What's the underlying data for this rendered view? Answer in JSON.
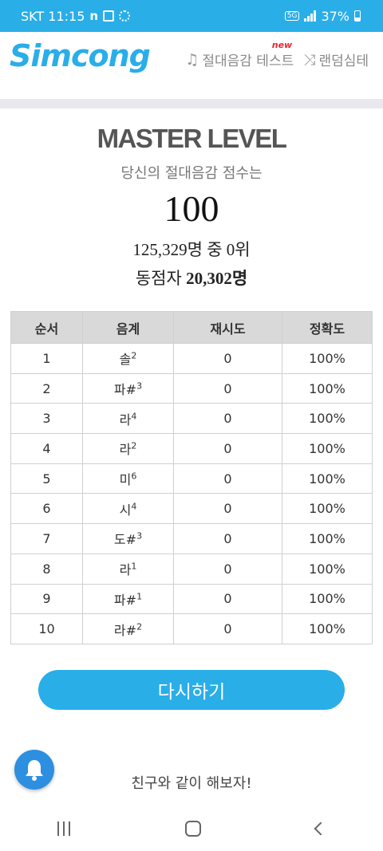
{
  "status_bar": {
    "carrier_time": "SKT 11:15",
    "battery": "37%",
    "network": "5G"
  },
  "header": {
    "logo": "Simcong",
    "nav_test": "절대음감 테스트",
    "nav_new": "new",
    "nav_random": "랜덤심테"
  },
  "result": {
    "level": "MASTER LEVEL",
    "subtitle": "당신의 절대음감 점수는",
    "score": "100",
    "rank": "125,329명 중 0위",
    "ties_label": "동점자",
    "ties_value": "20,302명"
  },
  "table": {
    "headers": [
      "순서",
      "음계",
      "재시도",
      "정확도"
    ],
    "rows": [
      {
        "order": "1",
        "note": "솔",
        "octave": "2",
        "retries": "0",
        "accuracy": "100%"
      },
      {
        "order": "2",
        "note": "파#",
        "octave": "3",
        "retries": "0",
        "accuracy": "100%"
      },
      {
        "order": "3",
        "note": "라",
        "octave": "4",
        "retries": "0",
        "accuracy": "100%"
      },
      {
        "order": "4",
        "note": "라",
        "octave": "2",
        "retries": "0",
        "accuracy": "100%"
      },
      {
        "order": "5",
        "note": "미",
        "octave": "6",
        "retries": "0",
        "accuracy": "100%"
      },
      {
        "order": "6",
        "note": "시",
        "octave": "4",
        "retries": "0",
        "accuracy": "100%"
      },
      {
        "order": "7",
        "note": "도#",
        "octave": "3",
        "retries": "0",
        "accuracy": "100%"
      },
      {
        "order": "8",
        "note": "라",
        "octave": "1",
        "retries": "0",
        "accuracy": "100%"
      },
      {
        "order": "9",
        "note": "파#",
        "octave": "1",
        "retries": "0",
        "accuracy": "100%"
      },
      {
        "order": "10",
        "note": "라#",
        "octave": "2",
        "retries": "0",
        "accuracy": "100%"
      }
    ]
  },
  "actions": {
    "retry_label": "다시하기",
    "share_text": "친구와 같이 해보자!"
  },
  "icons": {
    "test_nav": "music-note-icon",
    "random_nav": "shuffle-icon",
    "notification": "bell-icon"
  },
  "colors": {
    "brand": "#29aee8",
    "bell": "#2d8fe0",
    "new_badge": "#e8262a"
  }
}
